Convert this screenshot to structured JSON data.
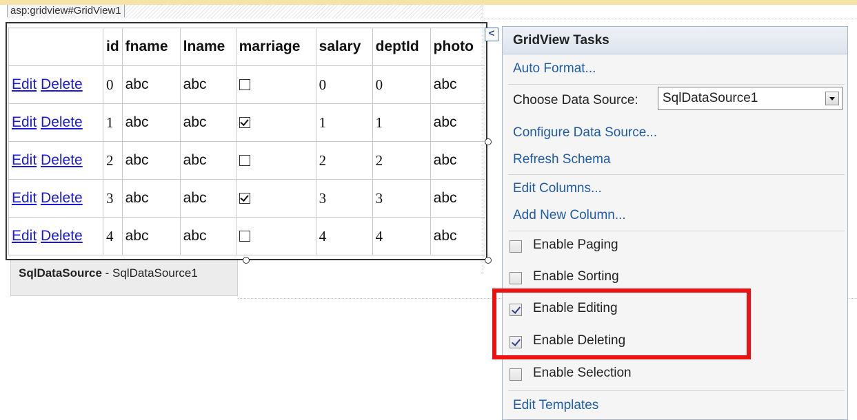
{
  "designer": {
    "control_tag": "asp:gridview#GridView1",
    "grid": {
      "columns": [
        "",
        "id",
        "fname",
        "lname",
        "marriage",
        "salary",
        "deptId",
        "photo"
      ],
      "edit_label": "Edit",
      "delete_label": "Delete",
      "rows": [
        {
          "id": "0",
          "fname": "abc",
          "lname": "abc",
          "marriage": false,
          "salary": "0",
          "deptId": "0",
          "photo": "abc"
        },
        {
          "id": "1",
          "fname": "abc",
          "lname": "abc",
          "marriage": true,
          "salary": "1",
          "deptId": "1",
          "photo": "abc"
        },
        {
          "id": "2",
          "fname": "abc",
          "lname": "abc",
          "marriage": false,
          "salary": "2",
          "deptId": "2",
          "photo": "abc"
        },
        {
          "id": "3",
          "fname": "abc",
          "lname": "abc",
          "marriage": true,
          "salary": "3",
          "deptId": "3",
          "photo": "abc"
        },
        {
          "id": "4",
          "fname": "abc",
          "lname": "abc",
          "marriage": false,
          "salary": "4",
          "deptId": "4",
          "photo": "abc"
        }
      ]
    },
    "datasource_tab": {
      "type": "SqlDataSource",
      "separator": " - ",
      "name": "SqlDataSource1"
    }
  },
  "tasks_panel": {
    "collapse_glyph": "<",
    "title": "GridView Tasks",
    "auto_format": "Auto Format...",
    "choose_data_source_label": "Choose Data Source:",
    "data_source_value": "SqlDataSource1",
    "configure_data_source": "Configure Data Source...",
    "refresh_schema": "Refresh Schema",
    "edit_columns": "Edit Columns...",
    "add_new_column": "Add New Column...",
    "options": [
      {
        "label": "Enable Paging",
        "checked": false
      },
      {
        "label": "Enable Sorting",
        "checked": false
      },
      {
        "label": "Enable Editing",
        "checked": true
      },
      {
        "label": "Enable Deleting",
        "checked": true
      },
      {
        "label": "Enable Selection",
        "checked": false
      }
    ],
    "edit_templates": "Edit Templates"
  },
  "colors": {
    "link": "#1f5ba8",
    "grid_link": "#1a1ad6",
    "highlight": "#ee1111"
  }
}
